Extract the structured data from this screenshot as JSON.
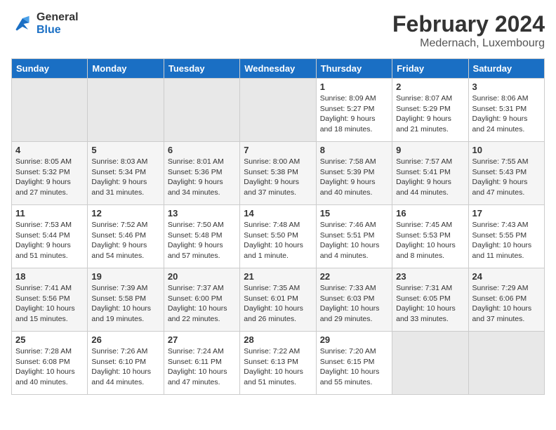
{
  "logo": {
    "text_general": "General",
    "text_blue": "Blue"
  },
  "title": "February 2024",
  "location": "Medernach, Luxembourg",
  "days_of_week": [
    "Sunday",
    "Monday",
    "Tuesday",
    "Wednesday",
    "Thursday",
    "Friday",
    "Saturday"
  ],
  "weeks": [
    [
      {
        "day": "",
        "info": ""
      },
      {
        "day": "",
        "info": ""
      },
      {
        "day": "",
        "info": ""
      },
      {
        "day": "",
        "info": ""
      },
      {
        "day": "1",
        "info": "Sunrise: 8:09 AM\nSunset: 5:27 PM\nDaylight: 9 hours\nand 18 minutes."
      },
      {
        "day": "2",
        "info": "Sunrise: 8:07 AM\nSunset: 5:29 PM\nDaylight: 9 hours\nand 21 minutes."
      },
      {
        "day": "3",
        "info": "Sunrise: 8:06 AM\nSunset: 5:31 PM\nDaylight: 9 hours\nand 24 minutes."
      }
    ],
    [
      {
        "day": "4",
        "info": "Sunrise: 8:05 AM\nSunset: 5:32 PM\nDaylight: 9 hours\nand 27 minutes."
      },
      {
        "day": "5",
        "info": "Sunrise: 8:03 AM\nSunset: 5:34 PM\nDaylight: 9 hours\nand 31 minutes."
      },
      {
        "day": "6",
        "info": "Sunrise: 8:01 AM\nSunset: 5:36 PM\nDaylight: 9 hours\nand 34 minutes."
      },
      {
        "day": "7",
        "info": "Sunrise: 8:00 AM\nSunset: 5:38 PM\nDaylight: 9 hours\nand 37 minutes."
      },
      {
        "day": "8",
        "info": "Sunrise: 7:58 AM\nSunset: 5:39 PM\nDaylight: 9 hours\nand 40 minutes."
      },
      {
        "day": "9",
        "info": "Sunrise: 7:57 AM\nSunset: 5:41 PM\nDaylight: 9 hours\nand 44 minutes."
      },
      {
        "day": "10",
        "info": "Sunrise: 7:55 AM\nSunset: 5:43 PM\nDaylight: 9 hours\nand 47 minutes."
      }
    ],
    [
      {
        "day": "11",
        "info": "Sunrise: 7:53 AM\nSunset: 5:44 PM\nDaylight: 9 hours\nand 51 minutes."
      },
      {
        "day": "12",
        "info": "Sunrise: 7:52 AM\nSunset: 5:46 PM\nDaylight: 9 hours\nand 54 minutes."
      },
      {
        "day": "13",
        "info": "Sunrise: 7:50 AM\nSunset: 5:48 PM\nDaylight: 9 hours\nand 57 minutes."
      },
      {
        "day": "14",
        "info": "Sunrise: 7:48 AM\nSunset: 5:50 PM\nDaylight: 10 hours\nand 1 minute."
      },
      {
        "day": "15",
        "info": "Sunrise: 7:46 AM\nSunset: 5:51 PM\nDaylight: 10 hours\nand 4 minutes."
      },
      {
        "day": "16",
        "info": "Sunrise: 7:45 AM\nSunset: 5:53 PM\nDaylight: 10 hours\nand 8 minutes."
      },
      {
        "day": "17",
        "info": "Sunrise: 7:43 AM\nSunset: 5:55 PM\nDaylight: 10 hours\nand 11 minutes."
      }
    ],
    [
      {
        "day": "18",
        "info": "Sunrise: 7:41 AM\nSunset: 5:56 PM\nDaylight: 10 hours\nand 15 minutes."
      },
      {
        "day": "19",
        "info": "Sunrise: 7:39 AM\nSunset: 5:58 PM\nDaylight: 10 hours\nand 19 minutes."
      },
      {
        "day": "20",
        "info": "Sunrise: 7:37 AM\nSunset: 6:00 PM\nDaylight: 10 hours\nand 22 minutes."
      },
      {
        "day": "21",
        "info": "Sunrise: 7:35 AM\nSunset: 6:01 PM\nDaylight: 10 hours\nand 26 minutes."
      },
      {
        "day": "22",
        "info": "Sunrise: 7:33 AM\nSunset: 6:03 PM\nDaylight: 10 hours\nand 29 minutes."
      },
      {
        "day": "23",
        "info": "Sunrise: 7:31 AM\nSunset: 6:05 PM\nDaylight: 10 hours\nand 33 minutes."
      },
      {
        "day": "24",
        "info": "Sunrise: 7:29 AM\nSunset: 6:06 PM\nDaylight: 10 hours\nand 37 minutes."
      }
    ],
    [
      {
        "day": "25",
        "info": "Sunrise: 7:28 AM\nSunset: 6:08 PM\nDaylight: 10 hours\nand 40 minutes."
      },
      {
        "day": "26",
        "info": "Sunrise: 7:26 AM\nSunset: 6:10 PM\nDaylight: 10 hours\nand 44 minutes."
      },
      {
        "day": "27",
        "info": "Sunrise: 7:24 AM\nSunset: 6:11 PM\nDaylight: 10 hours\nand 47 minutes."
      },
      {
        "day": "28",
        "info": "Sunrise: 7:22 AM\nSunset: 6:13 PM\nDaylight: 10 hours\nand 51 minutes."
      },
      {
        "day": "29",
        "info": "Sunrise: 7:20 AM\nSunset: 6:15 PM\nDaylight: 10 hours\nand 55 minutes."
      },
      {
        "day": "",
        "info": ""
      },
      {
        "day": "",
        "info": ""
      }
    ]
  ]
}
